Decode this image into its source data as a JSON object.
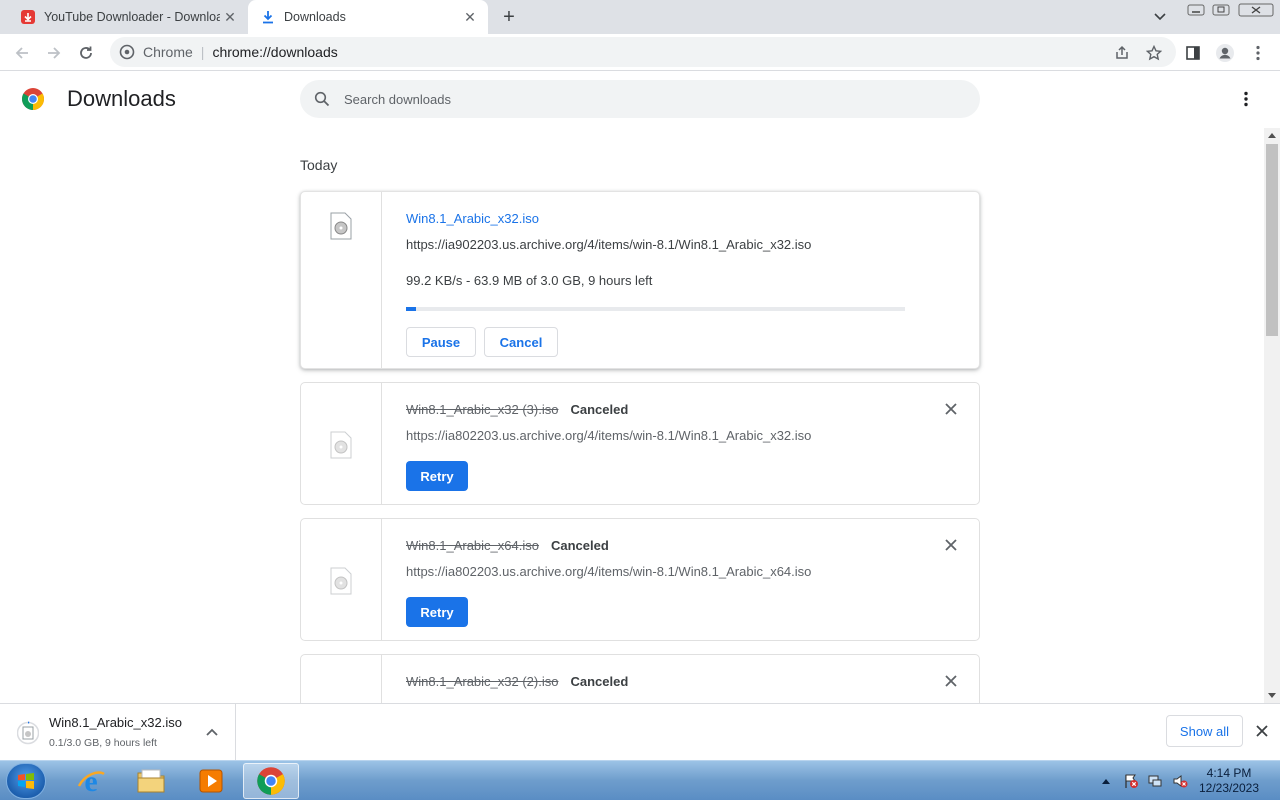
{
  "browser": {
    "tabs": [
      {
        "title": "YouTube Downloader - Download",
        "favicon": "download-red-icon"
      },
      {
        "title": "Downloads",
        "favicon": "download-arrow-icon",
        "active": true
      }
    ],
    "omnibox": {
      "site_label": "Chrome",
      "url": "chrome://downloads"
    }
  },
  "page": {
    "title": "Downloads",
    "search_placeholder": "Search downloads",
    "section": "Today"
  },
  "downloads": [
    {
      "filename": "Win8.1_Arabic_x32.iso",
      "url": "https://ia902203.us.archive.org/4/items/win-8.1/Win8.1_Arabic_x32.iso",
      "progress_text": "99.2 KB/s - 63.9 MB of 3.0 GB, 9 hours left",
      "progress_fraction": 0.021,
      "buttons": {
        "pause": "Pause",
        "cancel": "Cancel"
      }
    },
    {
      "filename": "Win8.1_Arabic_x32 (3).iso",
      "status": "Canceled",
      "url": "https://ia802203.us.archive.org/4/items/win-8.1/Win8.1_Arabic_x32.iso",
      "retry": "Retry"
    },
    {
      "filename": "Win8.1_Arabic_x64.iso",
      "status": "Canceled",
      "url": "https://ia802203.us.archive.org/4/items/win-8.1/Win8.1_Arabic_x64.iso",
      "retry": "Retry"
    },
    {
      "filename": "Win8.1_Arabic_x32 (2).iso",
      "status": "Canceled"
    }
  ],
  "shelf": {
    "filename": "Win8.1_Arabic_x32.iso",
    "status": "0.1/3.0 GB, 9 hours left",
    "show_all": "Show all"
  },
  "taskbar": {
    "time": "4:14 PM",
    "date": "12/23/2023",
    "apps": [
      "internet-explorer",
      "file-explorer",
      "media-player",
      "google-chrome"
    ]
  },
  "colors": {
    "accent": "#1a73e8",
    "tabstrip": "#dee1e6"
  }
}
